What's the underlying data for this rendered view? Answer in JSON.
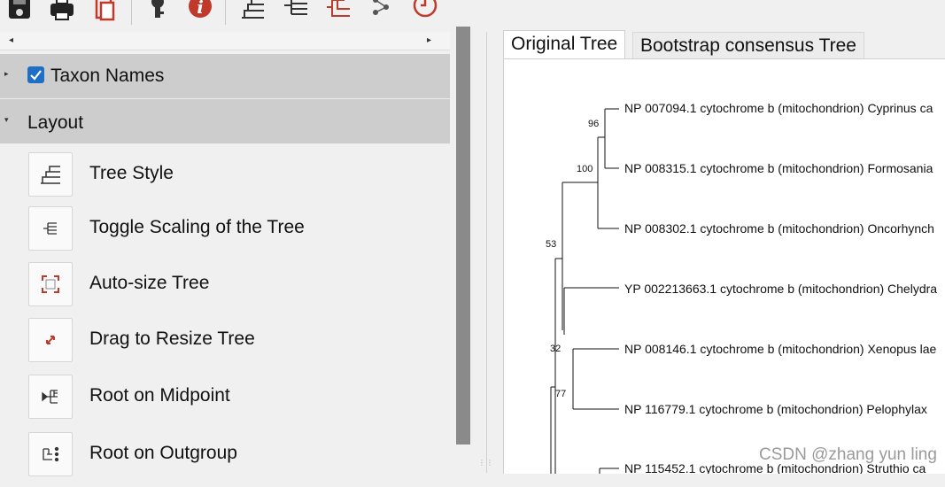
{
  "toolbar": {
    "buttons": [
      {
        "name": "save-icon"
      },
      {
        "name": "print-icon"
      },
      {
        "name": "copy-icon"
      },
      {
        "name": "key-icon"
      },
      {
        "name": "info-icon"
      },
      {
        "name": "tree-style-icon"
      },
      {
        "name": "scale-tree-icon"
      },
      {
        "name": "tree-colored-icon"
      },
      {
        "name": "branch-icon"
      },
      {
        "name": "timer-icon"
      }
    ]
  },
  "left_panel": {
    "scroll_left": "◂",
    "scroll_right": "▸",
    "groups": [
      {
        "label": "Taxon Names",
        "caret": "▸",
        "checked": true
      },
      {
        "label": "Layout",
        "caret": "▾"
      }
    ],
    "items": [
      {
        "label": "Tree Style",
        "icon": "tree-style-icon"
      },
      {
        "label": "Toggle Scaling of the Tree",
        "icon": "toggle-scaling-icon"
      },
      {
        "label": "Auto-size Tree",
        "icon": "auto-size-icon"
      },
      {
        "label": "Drag to Resize Tree",
        "icon": "drag-resize-icon"
      },
      {
        "label": "Root on Midpoint",
        "icon": "root-midpoint-icon"
      },
      {
        "label": "Root on Outgroup",
        "icon": "root-outgroup-icon"
      }
    ]
  },
  "tabs": {
    "original": "Original Tree",
    "bootstrap": "Bootstrap consensus Tree"
  },
  "tree": {
    "leaves": [
      "NP 007094.1 cytochrome b (mitochondrion) Cyprinus ca",
      "NP 008315.1 cytochrome b (mitochondrion) Formosania",
      "NP 008302.1 cytochrome b (mitochondrion) Oncorhynch",
      "YP 002213663.1 cytochrome b (mitochondrion) Chelydra",
      "NP 008146.1 cytochrome b (mitochondrion) Xenopus lae",
      "NP 116779.1 cytochrome b (mitochondrion) Pelophylax",
      "NP 115452.1 cytochrome b (mitochondrion) Struthio ca"
    ],
    "bootstrap_values": [
      "96",
      "100",
      "53",
      "32",
      "77"
    ]
  },
  "watermark": "CSDN @zhang yun ling",
  "colors": {
    "accent": "#1f6fc5",
    "icon_red": "#c0392b",
    "header_gray": "#cdcdcd"
  }
}
